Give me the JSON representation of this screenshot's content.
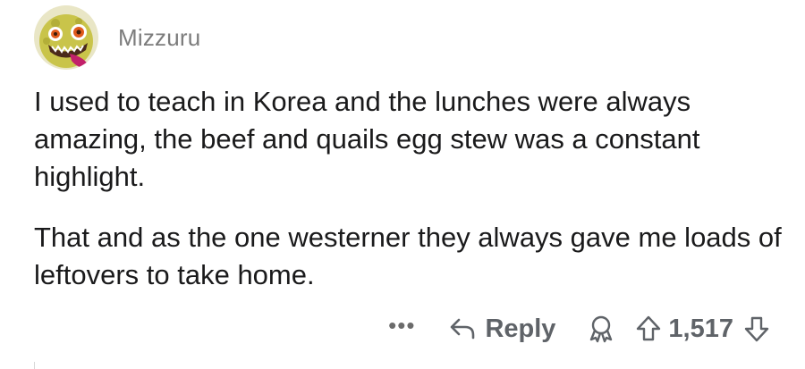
{
  "comment": {
    "username": "Mizzuru",
    "avatar_icon": "snoo-avatar-icon",
    "paragraphs": [
      "I used to teach in Korea and the lunches were always amazing, the beef and quails egg stew was a constant highlight.",
      "That and as the one westerner they always gave me loads of leftovers to take home."
    ]
  },
  "actions": {
    "more_label": "•••",
    "reply_label": "Reply",
    "vote_count": "1,517",
    "icons": [
      "more-icon",
      "reply-icon",
      "award-icon",
      "upvote-icon",
      "downvote-icon"
    ]
  },
  "colors": {
    "text": "#1a1a1b",
    "username": "#7c7c7c",
    "action": "#5f6368",
    "avatar_bg": "#d9d96a"
  }
}
